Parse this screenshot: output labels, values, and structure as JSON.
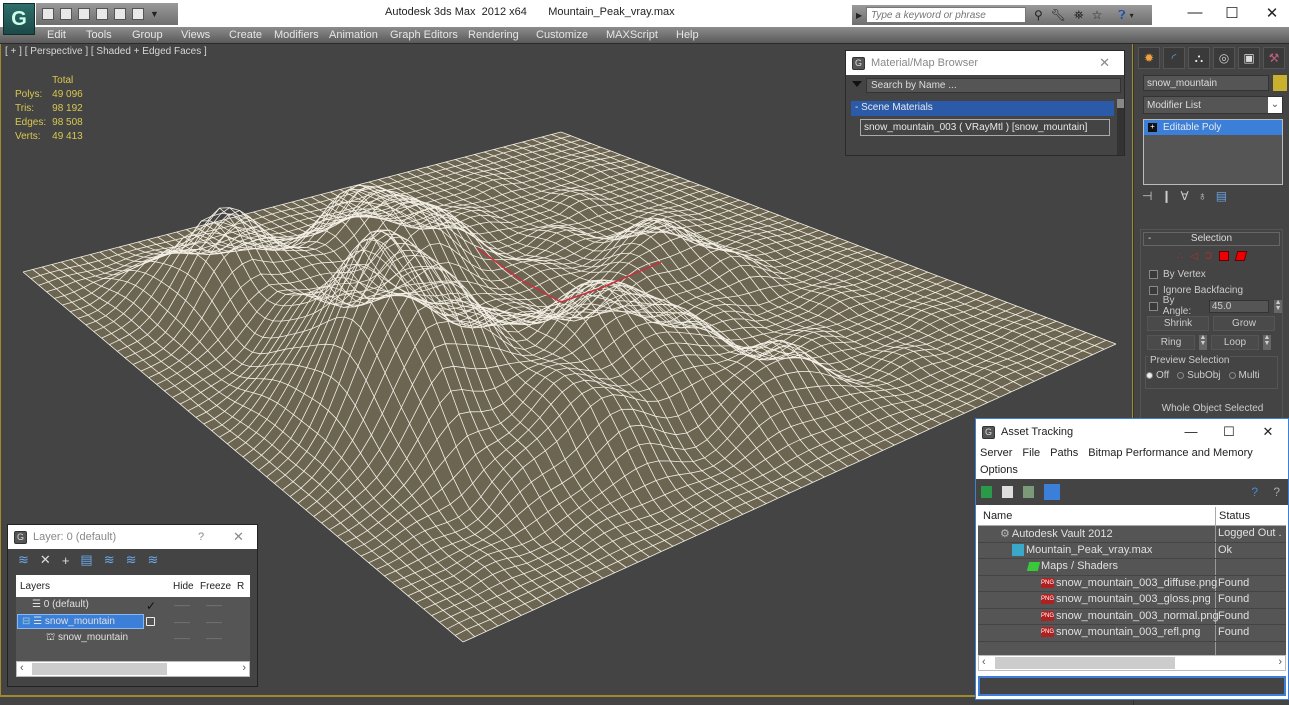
{
  "window": {
    "title": "Autodesk 3ds Max  2012 x64       Mountain_Peak_vray.max",
    "minimize_label": "—",
    "maximize_label": "☐",
    "close_label": "✕"
  },
  "infocenter": {
    "search_placeholder": "Type a keyword or phrase",
    "icons": [
      "binoculars-icon",
      "wrench-icon",
      "satellite-icon",
      "star-icon",
      "help-icon"
    ]
  },
  "menubar": {
    "items": [
      "Edit",
      "Tools",
      "Group",
      "Views",
      "Create",
      "Modifiers",
      "Animation",
      "Graph Editors",
      "Rendering",
      "Customize",
      "MAXScript",
      "Help"
    ]
  },
  "viewport": {
    "label": "[ + ] [ Perspective ] [ Shaded + Edged Faces ]",
    "stats": {
      "header": "Total",
      "rows": [
        {
          "label": "Polys:",
          "value": "49 096"
        },
        {
          "label": "Tris:",
          "value": "98 192"
        },
        {
          "label": "Edges:",
          "value": "98 508"
        },
        {
          "label": "Verts:",
          "value": "49 413"
        }
      ]
    },
    "colors": {
      "background": "#444444",
      "wire": "#f4f0e6",
      "surface": "#6b6552",
      "stats_text": "#d8c850"
    }
  },
  "material_browser": {
    "title": "Material/Map Browser",
    "close_label": "✕",
    "search_placeholder": "Search by Name ...",
    "category": "- Scene Materials",
    "items": [
      "snow_mountain_003  ( VRayMtl ) [snow_mountain]"
    ]
  },
  "command_panel": {
    "object_name": "snow_mountain",
    "object_color": "#c8b030",
    "modifier_list_label": "Modifier List",
    "stack": [
      "Editable Poly"
    ],
    "selection": {
      "title": "Selection",
      "by_vertex": "By Vertex",
      "ignore_backfacing": "Ignore Backfacing",
      "by_angle": "By Angle:",
      "angle_value": "45.0",
      "shrink": "Shrink",
      "grow": "Grow",
      "ring": "Ring",
      "loop": "Loop",
      "preview_title": "Preview Selection",
      "preview_options": [
        "Off",
        "SubObj",
        "Multi"
      ],
      "preview_selected": "Off",
      "status": "Whole Object Selected"
    }
  },
  "asset_tracking": {
    "title": "Asset Tracking",
    "menu": [
      "Server",
      "File",
      "Paths",
      "Bitmap Performance and Memory",
      "Options"
    ],
    "columns": [
      "Name",
      "Status"
    ],
    "rows": [
      {
        "name": "Autodesk Vault 2012",
        "status": "Logged Out .",
        "icon": "vault-icon",
        "indent": 1
      },
      {
        "name": "Mountain_Peak_vray.max",
        "status": "Ok",
        "icon": "max-file-icon",
        "indent": 2
      },
      {
        "name": "Maps / Shaders",
        "status": "",
        "icon": "maps-folder-icon",
        "indent": 3
      },
      {
        "name": "snow_mountain_003_diffuse.png",
        "status": "Found",
        "icon": "png-icon",
        "indent": 4
      },
      {
        "name": "snow_mountain_003_gloss.png",
        "status": "Found",
        "icon": "png-icon",
        "indent": 4
      },
      {
        "name": "snow_mountain_003_normal.png",
        "status": "Found",
        "icon": "png-icon",
        "indent": 4
      },
      {
        "name": "snow_mountain_003_refl.png",
        "status": "Found",
        "icon": "png-icon",
        "indent": 4
      }
    ]
  },
  "layer_manager": {
    "title": "Layer: 0 (default)",
    "help_label": "?",
    "close_label": "✕",
    "columns": [
      "Layers",
      "Hide",
      "Freeze",
      "R"
    ],
    "rows": [
      {
        "name": "0 (default)",
        "current": true,
        "selected": false
      },
      {
        "name": "snow_mountain",
        "current": false,
        "selected": true
      },
      {
        "name": "snow_mountain",
        "current": false,
        "selected": false,
        "is_object": true
      }
    ]
  }
}
